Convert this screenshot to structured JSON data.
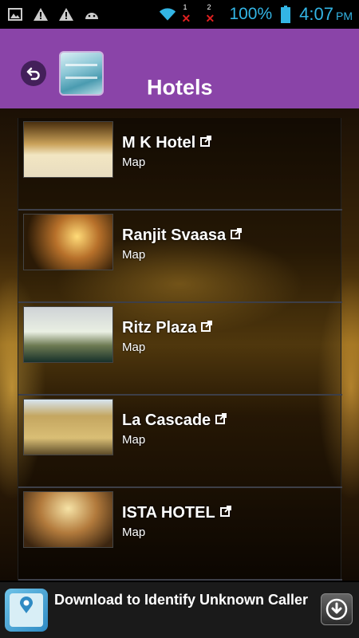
{
  "status_bar": {
    "battery": "100%",
    "time": "4:07",
    "ampm": "PM",
    "sim1_label": "1",
    "sim2_label": "2"
  },
  "header": {
    "title": "Hotels"
  },
  "hotels": [
    {
      "name": "M K Hotel",
      "map_label": "Map"
    },
    {
      "name": "Ranjit Svaasa",
      "map_label": "Map"
    },
    {
      "name": "Ritz Plaza",
      "map_label": "Map"
    },
    {
      "name": "La Cascade",
      "map_label": "Map"
    },
    {
      "name": "ISTA HOTEL",
      "map_label": "Map"
    }
  ],
  "ad": {
    "text": "Download to Identify Unknown Caller"
  },
  "colors": {
    "action_bar": "#8a44a8",
    "status_accent": "#33b5e5"
  }
}
